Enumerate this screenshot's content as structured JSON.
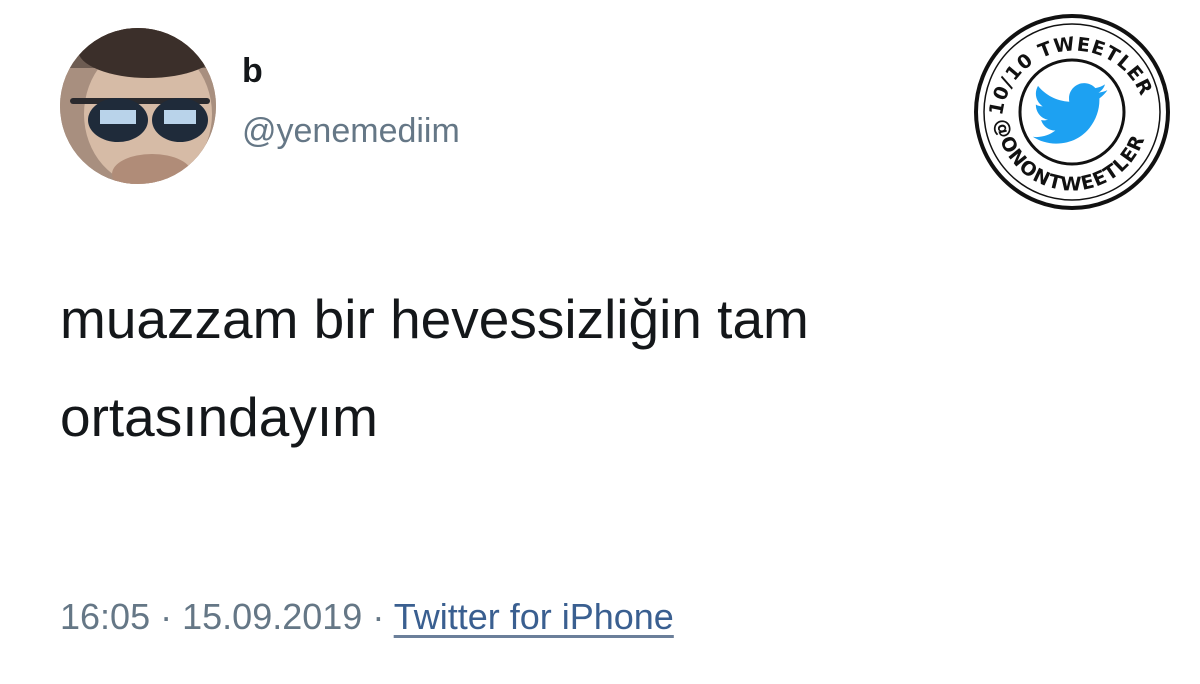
{
  "user": {
    "display_name": "b",
    "handle": "@yenemediim"
  },
  "tweet": {
    "text_line1": "muazzam bir hevessizliğin tam",
    "text_line2": "ortasındayım",
    "time": "16:05",
    "date": "15.09.2019",
    "separator": "·",
    "source": "Twitter for iPhone"
  },
  "watermark": {
    "top_text": "10/10 TWEETLER",
    "bottom_text": "@ONONTWEETLER",
    "icon": "twitter-bird-icon",
    "bird_color": "#1da1f2"
  },
  "colors": {
    "text": "#14171a",
    "secondary": "#657786",
    "link": "#3a5f90"
  }
}
